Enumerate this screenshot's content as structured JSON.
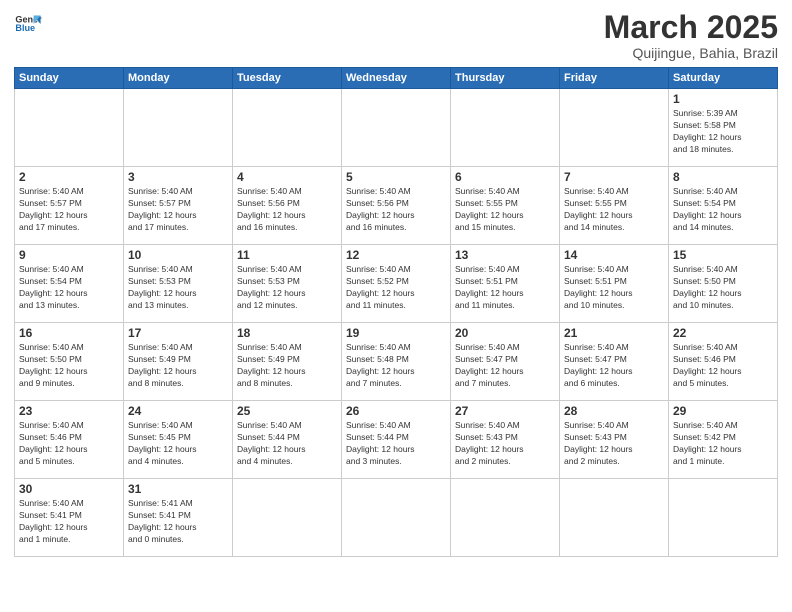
{
  "logo": {
    "line1": "General",
    "line2": "Blue"
  },
  "title": "March 2025",
  "subtitle": "Quijingue, Bahia, Brazil",
  "weekdays": [
    "Sunday",
    "Monday",
    "Tuesday",
    "Wednesday",
    "Thursday",
    "Friday",
    "Saturday"
  ],
  "weeks": [
    [
      {
        "day": "",
        "info": ""
      },
      {
        "day": "",
        "info": ""
      },
      {
        "day": "",
        "info": ""
      },
      {
        "day": "",
        "info": ""
      },
      {
        "day": "",
        "info": ""
      },
      {
        "day": "",
        "info": ""
      },
      {
        "day": "1",
        "info": "Sunrise: 5:39 AM\nSunset: 5:58 PM\nDaylight: 12 hours\nand 18 minutes."
      }
    ],
    [
      {
        "day": "2",
        "info": "Sunrise: 5:40 AM\nSunset: 5:57 PM\nDaylight: 12 hours\nand 17 minutes."
      },
      {
        "day": "3",
        "info": "Sunrise: 5:40 AM\nSunset: 5:57 PM\nDaylight: 12 hours\nand 17 minutes."
      },
      {
        "day": "4",
        "info": "Sunrise: 5:40 AM\nSunset: 5:56 PM\nDaylight: 12 hours\nand 16 minutes."
      },
      {
        "day": "5",
        "info": "Sunrise: 5:40 AM\nSunset: 5:56 PM\nDaylight: 12 hours\nand 16 minutes."
      },
      {
        "day": "6",
        "info": "Sunrise: 5:40 AM\nSunset: 5:55 PM\nDaylight: 12 hours\nand 15 minutes."
      },
      {
        "day": "7",
        "info": "Sunrise: 5:40 AM\nSunset: 5:55 PM\nDaylight: 12 hours\nand 14 minutes."
      },
      {
        "day": "8",
        "info": "Sunrise: 5:40 AM\nSunset: 5:54 PM\nDaylight: 12 hours\nand 14 minutes."
      }
    ],
    [
      {
        "day": "9",
        "info": "Sunrise: 5:40 AM\nSunset: 5:54 PM\nDaylight: 12 hours\nand 13 minutes."
      },
      {
        "day": "10",
        "info": "Sunrise: 5:40 AM\nSunset: 5:53 PM\nDaylight: 12 hours\nand 13 minutes."
      },
      {
        "day": "11",
        "info": "Sunrise: 5:40 AM\nSunset: 5:53 PM\nDaylight: 12 hours\nand 12 minutes."
      },
      {
        "day": "12",
        "info": "Sunrise: 5:40 AM\nSunset: 5:52 PM\nDaylight: 12 hours\nand 11 minutes."
      },
      {
        "day": "13",
        "info": "Sunrise: 5:40 AM\nSunset: 5:51 PM\nDaylight: 12 hours\nand 11 minutes."
      },
      {
        "day": "14",
        "info": "Sunrise: 5:40 AM\nSunset: 5:51 PM\nDaylight: 12 hours\nand 10 minutes."
      },
      {
        "day": "15",
        "info": "Sunrise: 5:40 AM\nSunset: 5:50 PM\nDaylight: 12 hours\nand 10 minutes."
      }
    ],
    [
      {
        "day": "16",
        "info": "Sunrise: 5:40 AM\nSunset: 5:50 PM\nDaylight: 12 hours\nand 9 minutes."
      },
      {
        "day": "17",
        "info": "Sunrise: 5:40 AM\nSunset: 5:49 PM\nDaylight: 12 hours\nand 8 minutes."
      },
      {
        "day": "18",
        "info": "Sunrise: 5:40 AM\nSunset: 5:49 PM\nDaylight: 12 hours\nand 8 minutes."
      },
      {
        "day": "19",
        "info": "Sunrise: 5:40 AM\nSunset: 5:48 PM\nDaylight: 12 hours\nand 7 minutes."
      },
      {
        "day": "20",
        "info": "Sunrise: 5:40 AM\nSunset: 5:47 PM\nDaylight: 12 hours\nand 7 minutes."
      },
      {
        "day": "21",
        "info": "Sunrise: 5:40 AM\nSunset: 5:47 PM\nDaylight: 12 hours\nand 6 minutes."
      },
      {
        "day": "22",
        "info": "Sunrise: 5:40 AM\nSunset: 5:46 PM\nDaylight: 12 hours\nand 5 minutes."
      }
    ],
    [
      {
        "day": "23",
        "info": "Sunrise: 5:40 AM\nSunset: 5:46 PM\nDaylight: 12 hours\nand 5 minutes."
      },
      {
        "day": "24",
        "info": "Sunrise: 5:40 AM\nSunset: 5:45 PM\nDaylight: 12 hours\nand 4 minutes."
      },
      {
        "day": "25",
        "info": "Sunrise: 5:40 AM\nSunset: 5:44 PM\nDaylight: 12 hours\nand 4 minutes."
      },
      {
        "day": "26",
        "info": "Sunrise: 5:40 AM\nSunset: 5:44 PM\nDaylight: 12 hours\nand 3 minutes."
      },
      {
        "day": "27",
        "info": "Sunrise: 5:40 AM\nSunset: 5:43 PM\nDaylight: 12 hours\nand 2 minutes."
      },
      {
        "day": "28",
        "info": "Sunrise: 5:40 AM\nSunset: 5:43 PM\nDaylight: 12 hours\nand 2 minutes."
      },
      {
        "day": "29",
        "info": "Sunrise: 5:40 AM\nSunset: 5:42 PM\nDaylight: 12 hours\nand 1 minute."
      }
    ],
    [
      {
        "day": "30",
        "info": "Sunrise: 5:40 AM\nSunset: 5:41 PM\nDaylight: 12 hours\nand 1 minute."
      },
      {
        "day": "31",
        "info": "Sunrise: 5:41 AM\nSunset: 5:41 PM\nDaylight: 12 hours\nand 0 minutes."
      },
      {
        "day": "",
        "info": ""
      },
      {
        "day": "",
        "info": ""
      },
      {
        "day": "",
        "info": ""
      },
      {
        "day": "",
        "info": ""
      },
      {
        "day": "",
        "info": ""
      }
    ]
  ]
}
